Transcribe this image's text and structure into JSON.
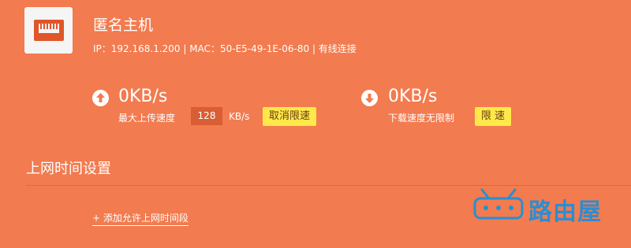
{
  "device": {
    "name": "匿名主机",
    "info": "IP：192.168.1.200 | MAC：50-E5-49-1E-06-80 | 有线连接",
    "icon": "ethernet-port-icon"
  },
  "upload": {
    "speed": "0KB/s",
    "label": "最大上传速度",
    "limit_value": "128",
    "unit": "KB/s",
    "button_label": "取消限速",
    "icon": "upload-arrow-icon"
  },
  "download": {
    "speed": "0KB/s",
    "label": "下载速度无限制",
    "button_label": "限 速",
    "icon": "download-arrow-icon"
  },
  "schedule": {
    "title": "上网时间设置",
    "add_link": "+ 添加允许上网时间段"
  },
  "watermark": {
    "text": "路由屋",
    "icon": "router-logo-icon"
  },
  "colors": {
    "background": "#f27b4f",
    "button": "#ffe94a",
    "watermark": "#2a8ed2"
  }
}
